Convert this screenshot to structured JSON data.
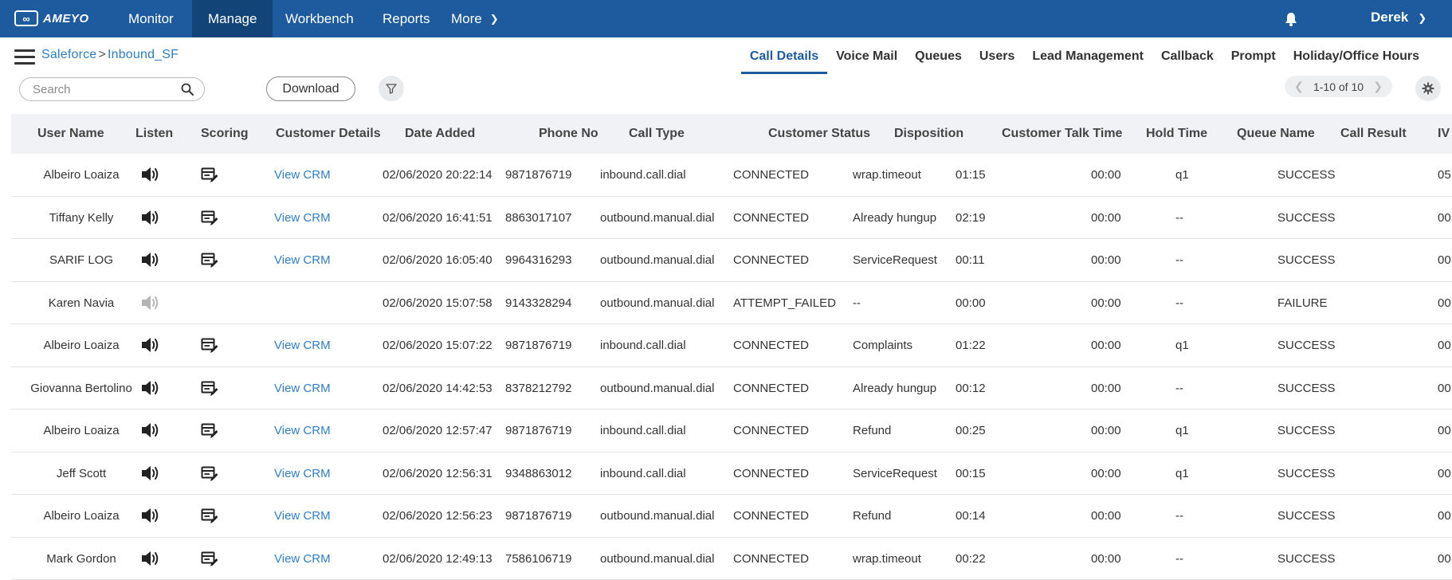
{
  "brand": {
    "logo_text": "AMEYO"
  },
  "nav": {
    "items": [
      {
        "label": "Monitor",
        "active": false
      },
      {
        "label": "Manage",
        "active": true
      },
      {
        "label": "Workbench",
        "active": false
      },
      {
        "label": "Reports",
        "active": false
      },
      {
        "label": "More",
        "active": false
      }
    ],
    "user": "Derek"
  },
  "breadcrumb": {
    "root": "Saleforce",
    "separator": ">",
    "current": "Inbound_SF"
  },
  "tabs": [
    {
      "label": "Call Details",
      "active": true
    },
    {
      "label": "Voice Mail",
      "active": false
    },
    {
      "label": "Queues",
      "active": false
    },
    {
      "label": "Users",
      "active": false
    },
    {
      "label": "Lead Management",
      "active": false
    },
    {
      "label": "Callback",
      "active": false
    },
    {
      "label": "Prompt",
      "active": false
    },
    {
      "label": "Holiday/Office Hours",
      "active": false
    }
  ],
  "toolbar": {
    "search_placeholder": "Search",
    "download_label": "Download",
    "pager_label": "1-10 of 10"
  },
  "colors": {
    "nav_bg": "#1d5b9e",
    "nav_active": "#124478",
    "link": "#2f7ec2"
  },
  "table": {
    "columns": [
      "User Name",
      "Listen",
      "Scoring",
      "Customer Details",
      "Date Added",
      "Phone No",
      "Call Type",
      "Customer Status",
      "Disposition",
      "Customer Talk Time",
      "Hold Time",
      "Queue Name",
      "Call Result",
      "IV"
    ],
    "view_crm_label": "View CRM",
    "rows": [
      {
        "user": "Albeiro Loaiza",
        "listen_enabled": true,
        "scoring": true,
        "crm": true,
        "date": "02/06/2020 20:22:14",
        "phone": "9871876719",
        "call_type": "inbound.call.dial",
        "status": "CONNECTED",
        "disposition": "wrap.timeout",
        "talk_time": "01:15",
        "hold_time": "00:00",
        "queue": "q1",
        "result": "SUCCESS",
        "iv": "05"
      },
      {
        "user": "Tiffany Kelly",
        "listen_enabled": true,
        "scoring": true,
        "crm": true,
        "date": "02/06/2020 16:41:51",
        "phone": "8863017107",
        "call_type": "outbound.manual.dial",
        "status": "CONNECTED",
        "disposition": "Already hungup",
        "talk_time": "02:19",
        "hold_time": "00:00",
        "queue": "--",
        "result": "SUCCESS",
        "iv": "00"
      },
      {
        "user": "SARIF LOG",
        "listen_enabled": true,
        "scoring": true,
        "crm": true,
        "date": "02/06/2020 16:05:40",
        "phone": "9964316293",
        "call_type": "outbound.manual.dial",
        "status": "CONNECTED",
        "disposition": "ServiceRequest",
        "talk_time": "00:11",
        "hold_time": "00:00",
        "queue": "--",
        "result": "SUCCESS",
        "iv": "00"
      },
      {
        "user": "Karen Navia",
        "listen_enabled": false,
        "scoring": false,
        "crm": false,
        "date": "02/06/2020 15:07:58",
        "phone": "9143328294",
        "call_type": "outbound.manual.dial",
        "status": "ATTEMPT_FAILED",
        "disposition": "--",
        "talk_time": "00:00",
        "hold_time": "00:00",
        "queue": "--",
        "result": "FAILURE",
        "iv": "00"
      },
      {
        "user": "Albeiro Loaiza",
        "listen_enabled": true,
        "scoring": true,
        "crm": true,
        "date": "02/06/2020 15:07:22",
        "phone": "9871876719",
        "call_type": "inbound.call.dial",
        "status": "CONNECTED",
        "disposition": "Complaints",
        "talk_time": "01:22",
        "hold_time": "00:00",
        "queue": "q1",
        "result": "SUCCESS",
        "iv": "00"
      },
      {
        "user": "Giovanna Bertolino",
        "listen_enabled": true,
        "scoring": true,
        "crm": true,
        "date": "02/06/2020 14:42:53",
        "phone": "8378212792",
        "call_type": "outbound.manual.dial",
        "status": "CONNECTED",
        "disposition": "Already hungup",
        "talk_time": "00:12",
        "hold_time": "00:00",
        "queue": "--",
        "result": "SUCCESS",
        "iv": "00"
      },
      {
        "user": "Albeiro Loaiza",
        "listen_enabled": true,
        "scoring": true,
        "crm": true,
        "date": "02/06/2020 12:57:47",
        "phone": "9871876719",
        "call_type": "inbound.call.dial",
        "status": "CONNECTED",
        "disposition": "Refund",
        "talk_time": "00:25",
        "hold_time": "00:00",
        "queue": "q1",
        "result": "SUCCESS",
        "iv": "00"
      },
      {
        "user": "Jeff Scott",
        "listen_enabled": true,
        "scoring": true,
        "crm": true,
        "date": "02/06/2020 12:56:31",
        "phone": "9348863012",
        "call_type": "inbound.call.dial",
        "status": "CONNECTED",
        "disposition": "ServiceRequest",
        "talk_time": "00:15",
        "hold_time": "00:00",
        "queue": "q1",
        "result": "SUCCESS",
        "iv": "00"
      },
      {
        "user": "Albeiro Loaiza",
        "listen_enabled": true,
        "scoring": true,
        "crm": true,
        "date": "02/06/2020 12:56:23",
        "phone": "9871876719",
        "call_type": "outbound.manual.dial",
        "status": "CONNECTED",
        "disposition": "Refund",
        "talk_time": "00:14",
        "hold_time": "00:00",
        "queue": "--",
        "result": "SUCCESS",
        "iv": "00"
      },
      {
        "user": "Mark Gordon",
        "listen_enabled": true,
        "scoring": true,
        "crm": true,
        "date": "02/06/2020 12:49:13",
        "phone": "7586106719",
        "call_type": "outbound.manual.dial",
        "status": "CONNECTED",
        "disposition": "wrap.timeout",
        "talk_time": "00:22",
        "hold_time": "00:00",
        "queue": "--",
        "result": "SUCCESS",
        "iv": "00"
      }
    ]
  }
}
